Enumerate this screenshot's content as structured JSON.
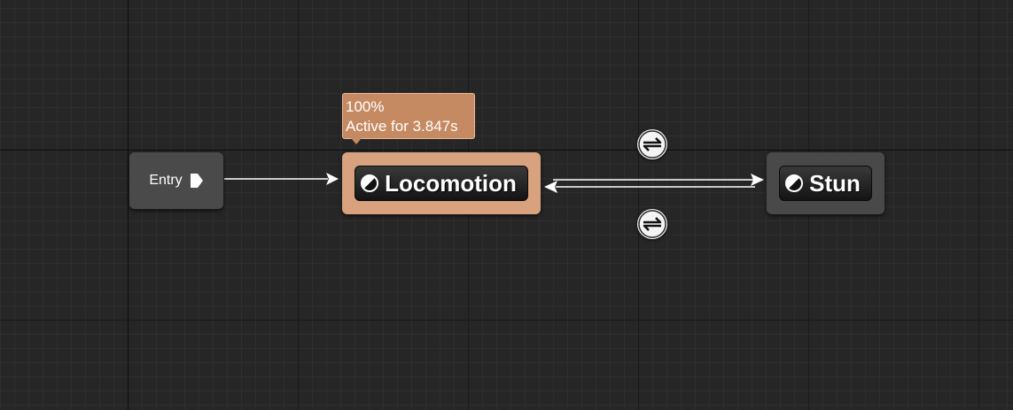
{
  "graph": {
    "entry": {
      "label": "Entry",
      "pin_icon": "output-pin-icon"
    },
    "states": {
      "locomotion": {
        "label": "Locomotion",
        "icon": "state-icon",
        "active": true,
        "color": "#d8a27f"
      },
      "stun": {
        "label": "Stun",
        "icon": "state-icon",
        "active": false,
        "color": "#494949"
      }
    },
    "tooltip": {
      "percent": "100%",
      "active_time": "Active for 3.847s"
    },
    "transitions": [
      {
        "from": "Locomotion",
        "to": "Stun",
        "icon": "transition-rule-icon"
      },
      {
        "from": "Stun",
        "to": "Locomotion",
        "icon": "transition-rule-icon"
      }
    ],
    "colors": {
      "background": "#262626",
      "active_state": "#d8a27f",
      "wire": "#ffffff"
    }
  }
}
